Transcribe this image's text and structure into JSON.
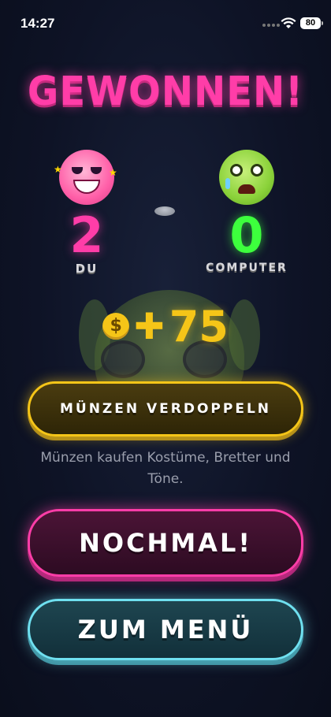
{
  "status_bar": {
    "time": "14:27",
    "battery": "80"
  },
  "result": {
    "title": "GEWONNEN!"
  },
  "players": [
    {
      "label": "DU",
      "score": "2",
      "face": "happy-pink-axolotl"
    },
    {
      "label": "COMPUTER",
      "score": "0",
      "face": "crying-green-axolotl"
    }
  ],
  "reward": {
    "coin_symbol": "$",
    "plus": "✚",
    "amount": "75"
  },
  "buttons": {
    "double": "MÜNZEN VERDOPPELN",
    "again": "NOCHMAL!",
    "menu": "ZUM MENÜ"
  },
  "hint": "Münzen kaufen Kostüme, Bretter und Töne.",
  "colors": {
    "pink": "#ff3da8",
    "green": "#3dff3d",
    "gold": "#f5c518",
    "cyan": "#6fe0f0"
  }
}
